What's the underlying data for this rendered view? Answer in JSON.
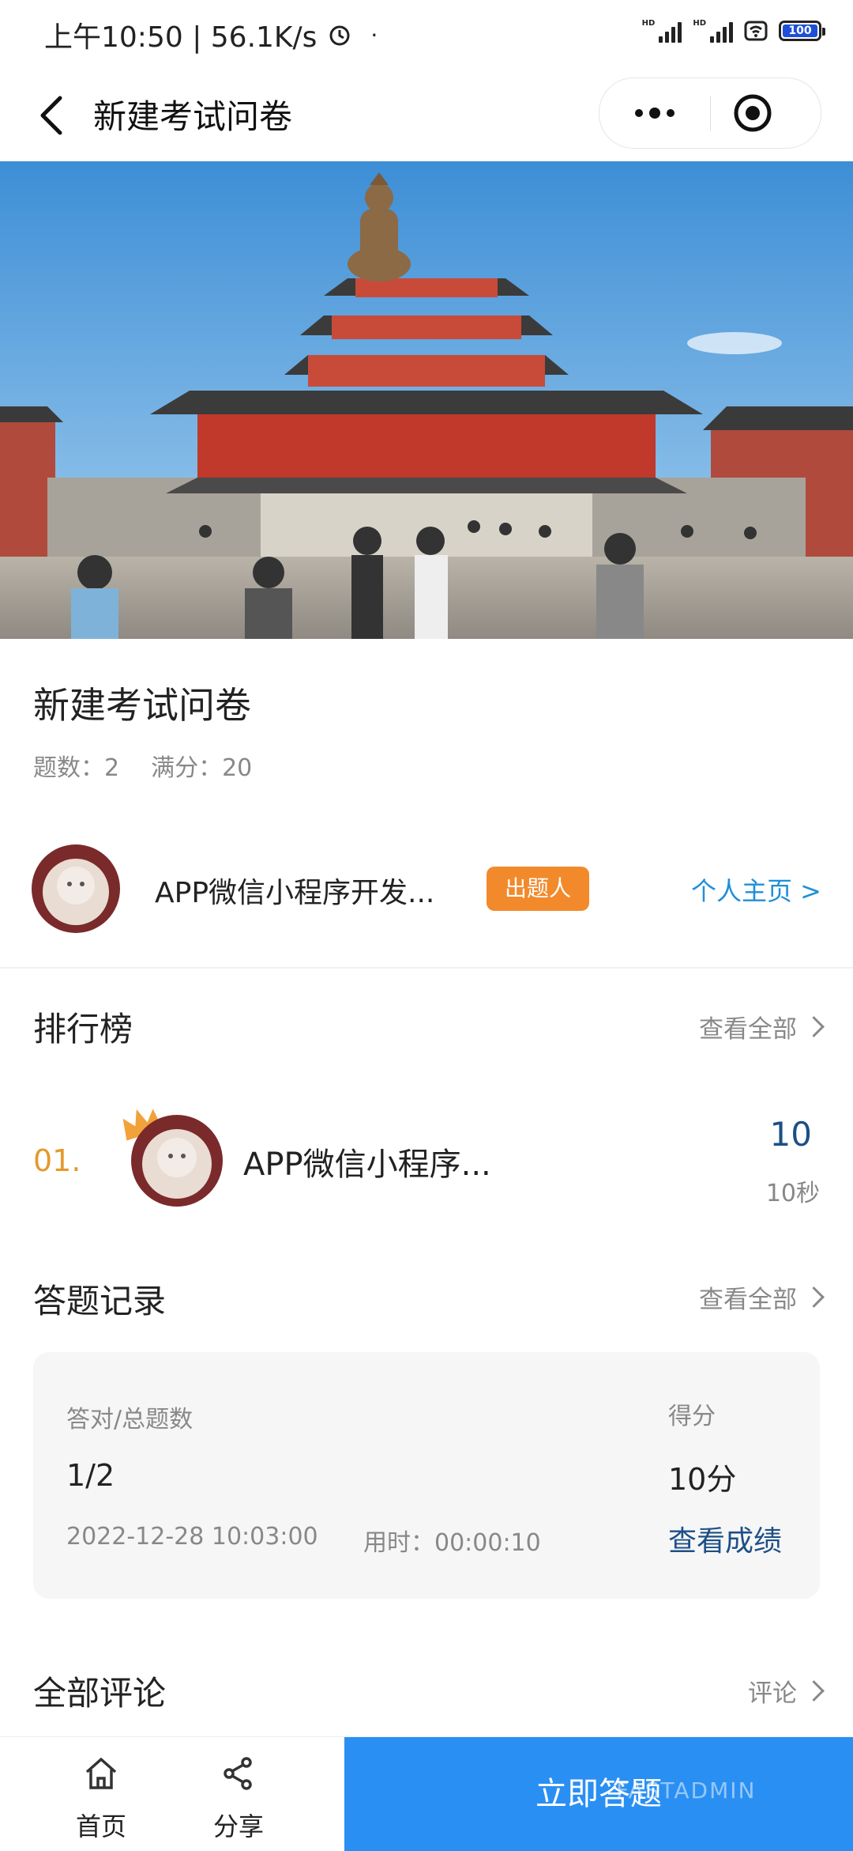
{
  "status_bar": {
    "time_speed": "上午10:50 | 56.1K/s",
    "battery": "100"
  },
  "nav": {
    "title": "新建考试问卷"
  },
  "exam": {
    "title": "新建考试问卷",
    "question_count": "题数：2",
    "full_score": "满分：20"
  },
  "author": {
    "name": "APP微信小程序开发...",
    "badge": "出题人",
    "home_link": "个人主页 >"
  },
  "ranking": {
    "title": "排行榜",
    "view_all": "查看全部",
    "rows": [
      {
        "rank": "01.",
        "name": "APP微信小程序...",
        "score": "10",
        "time": "10秒"
      }
    ]
  },
  "records": {
    "title": "答题记录",
    "view_all": "查看全部",
    "correct_label": "答对/总题数",
    "correct_value": "1/2",
    "score_label": "得分",
    "score_value": "10分",
    "datetime": "2022-12-28 10:03:00",
    "duration": "用时：00:00:10",
    "view_result": "查看成绩"
  },
  "comments": {
    "title": "全部评论",
    "action": "评论"
  },
  "bottom_bar": {
    "home_label": "首页",
    "share_label": "分享",
    "start_label": "立即答题",
    "watermark": "FASTADMIN"
  },
  "colors": {
    "accent_blue": "#2a8ff2",
    "link_blue": "#1f8fd8",
    "score_blue": "#1d4f86",
    "badge_orange": "#f28a2c",
    "rank_gold": "#e39a2e"
  }
}
